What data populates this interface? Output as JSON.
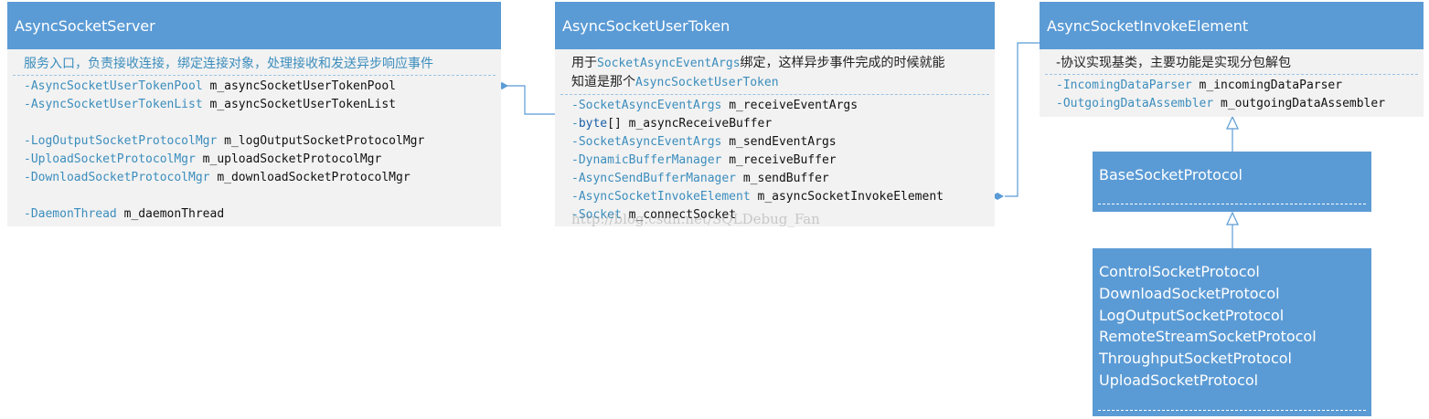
{
  "server": {
    "title": "AsyncSocketServer",
    "description": "服务入口，负责接收连接，绑定连接对象，处理接收和发送异步响应事件",
    "fields": [
      {
        "type": "-AsyncSocketUserTokenPool",
        "name": "m_asyncSocketUserTokenPool"
      },
      {
        "type": "-AsyncSocketUserTokenList",
        "name": "m_asyncSocketUserTokenList"
      },
      {
        "blank": true
      },
      {
        "type": "-LogOutputSocketProtocolMgr",
        "name": "m_logOutputSocketProtocolMgr"
      },
      {
        "type": "-UploadSocketProtocolMgr",
        "name": "m_uploadSocketProtocolMgr"
      },
      {
        "type": "-DownloadSocketProtocolMgr",
        "name": "m_downloadSocketProtocolMgr"
      },
      {
        "blank": true
      },
      {
        "type": "-DaemonThread",
        "name": "m_daemonThread"
      }
    ]
  },
  "token": {
    "title": "AsyncSocketUserToken",
    "desc_prefix": "用于",
    "desc_term1": "SocketAsyncEventArgs",
    "desc_middle": "绑定，这样异步事件完成的时候就能",
    "desc_line2_prefix": "知道是那个",
    "desc_term2": "AsyncSocketUserToken",
    "fields": [
      {
        "type": "-SocketAsyncEventArgs",
        "name": "m_receiveEventArgs"
      },
      {
        "prefix": "-",
        "kw": "byte",
        "rest": "[] m_asyncReceiveBuffer"
      },
      {
        "type": "-SocketAsyncEventArgs",
        "name": "m_sendEventArgs"
      },
      {
        "type": "-DynamicBufferManager",
        "name": "m_receiveBuffer"
      },
      {
        "type": "-AsyncSendBufferManager",
        "name": "m_sendBuffer"
      },
      {
        "type": "-AsyncSocketInvokeElement",
        "name": "m_asyncSocketInvokeElement"
      },
      {
        "type": "-Socket",
        "name": "m_connectSocket"
      }
    ],
    "watermark": "http://blog.csdn.net/SQLDebug_Fan"
  },
  "invoke": {
    "title": "AsyncSocketInvokeElement",
    "description": "-协议实现基类，主要功能是实现分包解包",
    "fields": [
      {
        "type": "-IncomingDataParser",
        "name": "m_incomingDataParser"
      },
      {
        "type": "-OutgoingDataAssembler",
        "name": "m_outgoingDataAssembler"
      }
    ]
  },
  "base": {
    "title": "BaseSocketProtocol"
  },
  "derived": {
    "items": [
      "ControlSocketProtocol",
      "DownloadSocketProtocol",
      "LogOutputSocketProtocol",
      "RemoteStreamSocketProtocol",
      "ThroughputSocketProtocol",
      "UploadSocketProtocol"
    ]
  },
  "colors": {
    "header": "#5b9bd5",
    "body": "#f2f2f2",
    "type_text": "#3b8dbd",
    "connector": "#5b9bd5"
  }
}
